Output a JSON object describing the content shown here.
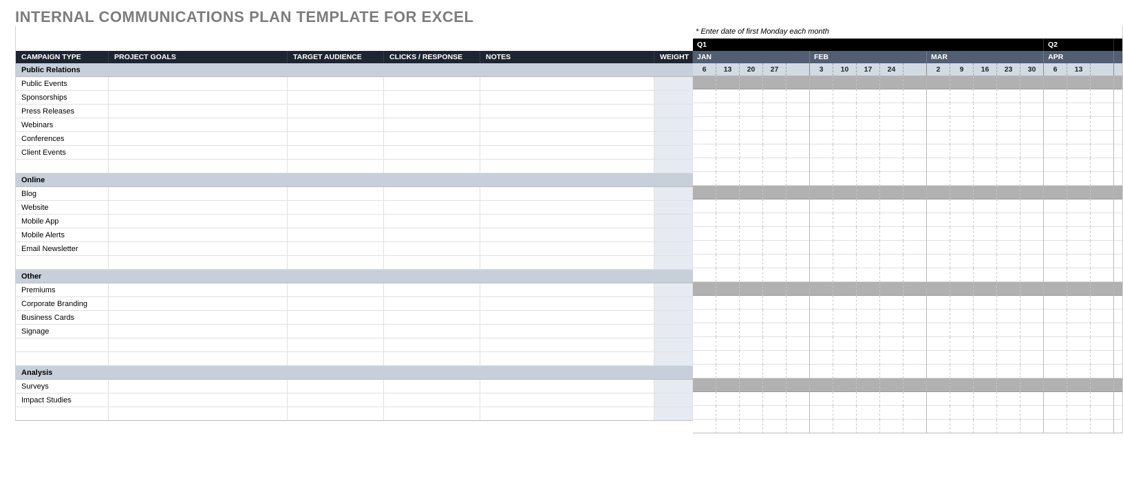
{
  "title": "INTERNAL COMMUNICATIONS PLAN TEMPLATE FOR EXCEL",
  "note": "* Enter date of first Monday each month",
  "columns": {
    "campaign": "CAMPAIGN TYPE",
    "goals": "PROJECT GOALS",
    "target": "TARGET AUDIENCE",
    "clicks": "CLICKS / RESPONSE",
    "notes": "NOTES",
    "weight": "WEIGHT"
  },
  "timeline": {
    "quarters": [
      {
        "label": "Q1",
        "weeks": 15
      },
      {
        "label": "Q2",
        "weeks": 3
      }
    ],
    "months": [
      {
        "label": "JAN",
        "weeks": 5
      },
      {
        "label": "FEB",
        "weeks": 5
      },
      {
        "label": "MAR",
        "weeks": 5
      },
      {
        "label": "APR",
        "weeks": 3
      }
    ],
    "weeks": [
      "6",
      "13",
      "20",
      "27",
      "",
      "3",
      "10",
      "17",
      "24",
      "",
      "2",
      "9",
      "16",
      "23",
      "30",
      "6",
      "13",
      ""
    ]
  },
  "sections": [
    {
      "name": "Public Relations",
      "rows": [
        "Public Events",
        "Sponsorships",
        "Press Releases",
        "Webinars",
        "Conferences",
        "Client Events",
        ""
      ]
    },
    {
      "name": "Online",
      "rows": [
        "Blog",
        "Website",
        "Mobile App",
        "Mobile Alerts",
        "Email Newsletter",
        ""
      ]
    },
    {
      "name": "Other",
      "rows": [
        "Premiums",
        "Corporate Branding",
        "Business Cards",
        "Signage",
        "",
        ""
      ]
    },
    {
      "name": "Analysis",
      "rows": [
        "Surveys",
        "Impact Studies",
        ""
      ]
    }
  ]
}
